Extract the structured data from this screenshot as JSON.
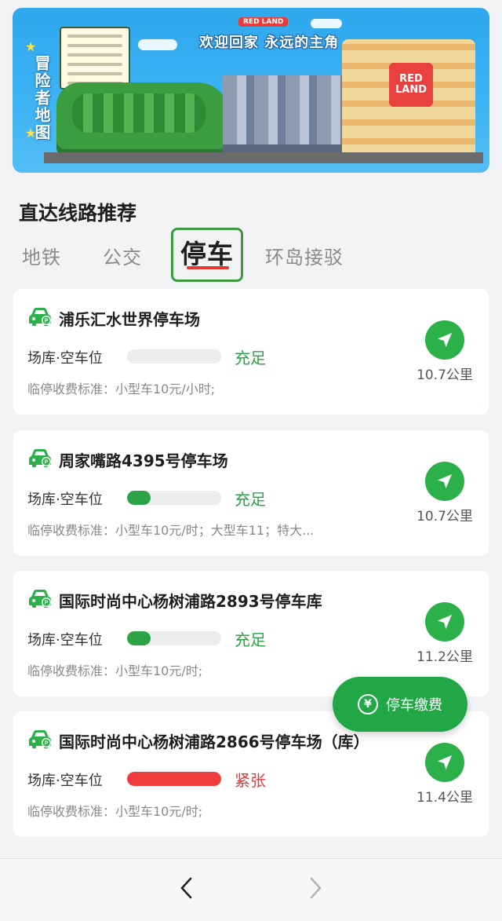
{
  "banner": {
    "side_label": "冒险者地图",
    "title": "欢迎回家 永远的主角",
    "logo": "RED LAND",
    "park_label": "RED LAND"
  },
  "section": {
    "title": "直达线路推荐"
  },
  "tabs": [
    {
      "label": "地铁",
      "active": false
    },
    {
      "label": "公交",
      "active": false
    },
    {
      "label": "停车",
      "active": true
    },
    {
      "label": "环岛接驳",
      "active": false
    }
  ],
  "parking": [
    {
      "name": "浦乐汇水世界停车场",
      "space_label": "场库·空车位",
      "status": "充足",
      "status_color": "#2ba245",
      "occupancy": 0,
      "bar_color": "#2ba245",
      "fee": "临停收费标准：小型车10元/小时;",
      "distance": "10.7公里"
    },
    {
      "name": "周家嘴路4395号停车场",
      "space_label": "场库·空车位",
      "status": "充足",
      "status_color": "#2ba245",
      "occupancy": 0.25,
      "bar_color": "#2ba245",
      "fee": "临停收费标准：小型车10元/时；大型车11；特大...",
      "distance": "10.7公里"
    },
    {
      "name": "国际时尚中心杨树浦路2893号停车库",
      "space_label": "场库·空车位",
      "status": "充足",
      "status_color": "#2ba245",
      "occupancy": 0.22,
      "bar_color": "#2ba245",
      "fee": "临停收费标准：小型车10元/时;",
      "distance": "11.2公里"
    },
    {
      "name": "国际时尚中心杨树浦路2866号停车场（库）",
      "space_label": "场库·空车位",
      "status": "紧张",
      "status_color": "#e53935",
      "occupancy": 1,
      "bar_color": "#ef3b3b",
      "fee": "临停收费标准：小型车10元/时;",
      "distance": "11.4公里"
    }
  ],
  "pay_button": {
    "label": "停车缴费",
    "icon": "yen-icon"
  },
  "nav": {
    "back_icon": "chevron-left-icon",
    "forward_icon": "chevron-right-icon"
  }
}
